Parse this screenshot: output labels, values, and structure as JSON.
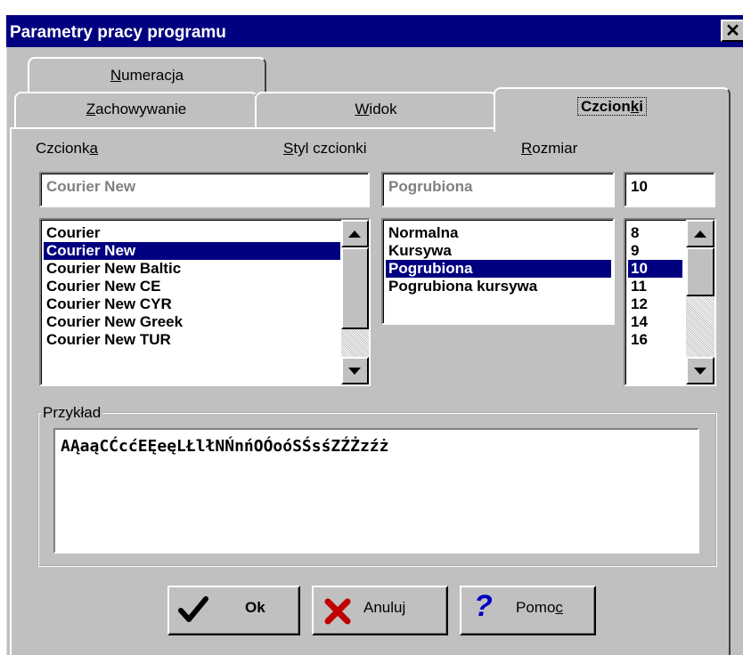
{
  "window": {
    "title": "Parametry pracy programu",
    "close_glyph": "✕"
  },
  "tabs": {
    "numeracja": {
      "before": "",
      "key": "N",
      "after": "umeracja"
    },
    "zachowywanie": {
      "before": "",
      "key": "Z",
      "after": "achowywanie"
    },
    "widok": {
      "before": "",
      "key": "W",
      "after": "idok"
    },
    "czcionki": {
      "before": "Czcion",
      "key": "k",
      "after": "i",
      "active": true
    }
  },
  "labels": {
    "font": {
      "before": "Czcionk",
      "key": "a",
      "after": ""
    },
    "style": {
      "before": "",
      "key": "S",
      "after": "tyl czcionki"
    },
    "size": {
      "before": "",
      "key": "R",
      "after": "ozmiar"
    }
  },
  "fields": {
    "font_value": "Courier New",
    "style_value": "Pogrubiona",
    "size_value": "10"
  },
  "font_list": [
    "Courier",
    "Courier New",
    "Courier New Baltic",
    "Courier New CE",
    "Courier New CYR",
    "Courier New Greek",
    "Courier New TUR"
  ],
  "font_selected": "Courier New",
  "style_list": [
    "Normalna",
    "Kursywa",
    "Pogrubiona",
    "Pogrubiona kursywa"
  ],
  "style_selected": "Pogrubiona",
  "size_list": [
    "8",
    "9",
    "10",
    "11",
    "12",
    "14",
    "16"
  ],
  "size_selected": "10",
  "sample": {
    "label": "Przykład",
    "text": "AĄaąCĆcćEĘeęLŁlłNŃnńOÓoóSŚsśZŹŻzźż"
  },
  "buttons": {
    "ok": {
      "label": "Ok",
      "icon": "checkmark-icon"
    },
    "cancel": {
      "label": "Anuluj",
      "icon": "red-x-icon"
    },
    "help": {
      "before": "Pomo",
      "key": "c",
      "after": "",
      "icon": "question-mark-icon"
    }
  },
  "colors": {
    "titlebar": "#000080",
    "face": "#c0c0c0",
    "selection": "#000080",
    "cancel_icon": "#c00000",
    "help_icon": "#0000c0"
  }
}
